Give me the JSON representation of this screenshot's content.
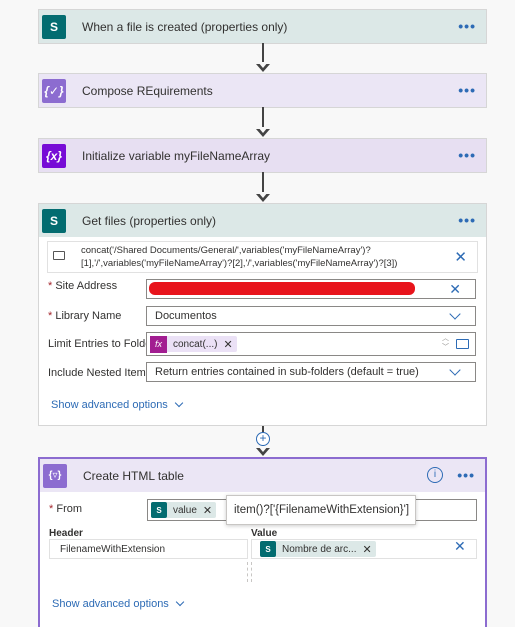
{
  "steps": {
    "trigger": {
      "title": "When a file is created (properties only)",
      "icon": "sharepoint-icon",
      "icon_text": "S",
      "more": "•••"
    },
    "compose": {
      "title": "Compose REquirements",
      "icon": "compose-icon",
      "icon_text": "{✓}",
      "more": "•••"
    },
    "init_var": {
      "title": "Initialize variable myFileNameArray",
      "icon": "variable-icon",
      "icon_text": "{x}",
      "more": "•••"
    },
    "get_files": {
      "title": "Get files (properties only)",
      "icon": "sharepoint-icon",
      "icon_text": "S",
      "more": "•••",
      "expression_line1": "concat('/Shared Documents/General/',variables('myFileNameArray')?",
      "expression_line2": "[1],'/',variables('myFileNameArray')?[2],'/',variables('myFileNameArray')?[3])",
      "site_address_label": "Site Address",
      "library_name_label": "Library Name",
      "library_name_value": "Documentos",
      "limit_folder_label": "Limit Entries to Folder",
      "limit_folder_token": "concat(...)",
      "nested_items_label": "Include Nested Items",
      "nested_items_value": "Return entries contained in sub-folders (default = true)",
      "show_advanced": "Show advanced options"
    },
    "create_html": {
      "title": "Create HTML table",
      "icon": "table-icon",
      "icon_text": "{▿}",
      "more": "•••",
      "from_label": "From",
      "from_token": "value",
      "tooltip": "item()?['{FilenameWithExtension}']",
      "header_col": "Header",
      "value_col": "Value",
      "header_value": "FilenameWithExtension",
      "value_token": "Nombre de arc...",
      "show_advanced": "Show advanced options"
    }
  },
  "colors": {
    "link": "#2d6bb5",
    "sharepoint": "#036c70",
    "redaction": "#e8141c"
  }
}
